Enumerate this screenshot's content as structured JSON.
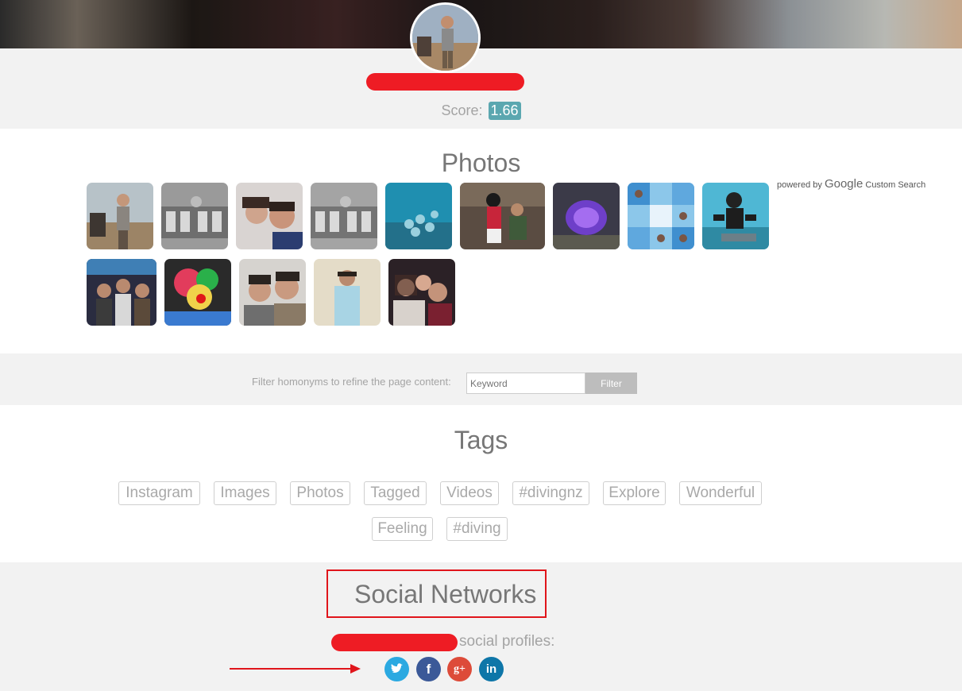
{
  "header": {
    "score_label": "Score:",
    "score_value": "1.66"
  },
  "photos": {
    "title": "Photos",
    "powered_by": "powered by",
    "google": "Google",
    "custom_search": "Custom Search"
  },
  "filter": {
    "label": "Filter homonyms to refine the page content:",
    "placeholder": "Keyword",
    "button": "Filter"
  },
  "tags": {
    "title": "Tags",
    "items": [
      "Instagram",
      "Images",
      "Photos",
      "Tagged",
      "Videos",
      "#divingnz",
      "Explore",
      "Wonderful",
      "Feeling",
      "#diving"
    ]
  },
  "social": {
    "title": "Social Networks",
    "profiles_text": "social profiles:",
    "icons": {
      "twitter": "twitter-icon",
      "facebook": "facebook-icon",
      "googleplus": "google-plus-icon",
      "linkedin": "linkedin-icon"
    },
    "colors": {
      "twitter": "#2ba9e1",
      "facebook": "#3b5998",
      "googleplus": "#dd4b39",
      "linkedin": "#0e76a8"
    },
    "glyphs": {
      "facebook": "f",
      "googleplus": "g+",
      "linkedin": "in"
    }
  },
  "colors": {
    "score_badge": "#5ba7b0",
    "band": "#f2f2f2",
    "annotation_red": "#e0151b"
  }
}
